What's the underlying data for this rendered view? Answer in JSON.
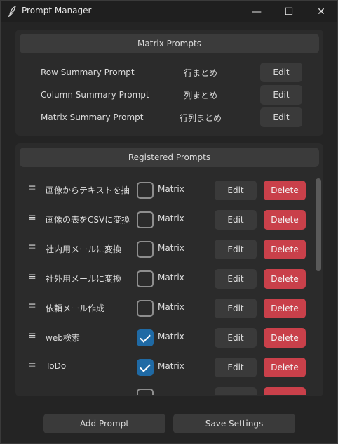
{
  "window": {
    "title": "Prompt Manager",
    "min_glyph": "—",
    "max_glyph": "☐",
    "close_glyph": "✕"
  },
  "matrix_prompts": {
    "header": "Matrix Prompts",
    "items": [
      {
        "label": "Row Summary Prompt",
        "value": "行まとめ",
        "edit_label": "Edit"
      },
      {
        "label": "Column Summary Prompt",
        "value": "列まとめ",
        "edit_label": "Edit"
      },
      {
        "label": "Matrix Summary Prompt",
        "value": "行列まとめ",
        "edit_label": "Edit"
      }
    ]
  },
  "registered_prompts": {
    "header": "Registered Prompts",
    "matrix_label": "Matrix",
    "edit_label": "Edit",
    "delete_label": "Delete",
    "drag_glyph": "≡",
    "items": [
      {
        "name": "画像からテキストを抽出",
        "matrix": false
      },
      {
        "name": "画像の表をCSVに変換",
        "matrix": false
      },
      {
        "name": "社内用メールに変換",
        "matrix": false
      },
      {
        "name": "社外用メールに変換",
        "matrix": false
      },
      {
        "name": "依頼メール作成",
        "matrix": false
      },
      {
        "name": "web検索",
        "matrix": true
      },
      {
        "name": "ToDo",
        "matrix": true
      }
    ]
  },
  "footer": {
    "add_label": "Add Prompt",
    "save_label": "Save Settings"
  },
  "colors": {
    "background": "#242424",
    "panel": "#2b2b2b",
    "button": "#3a3a3a",
    "delete": "#c9404a",
    "checkbox_on": "#1f6aa5"
  }
}
